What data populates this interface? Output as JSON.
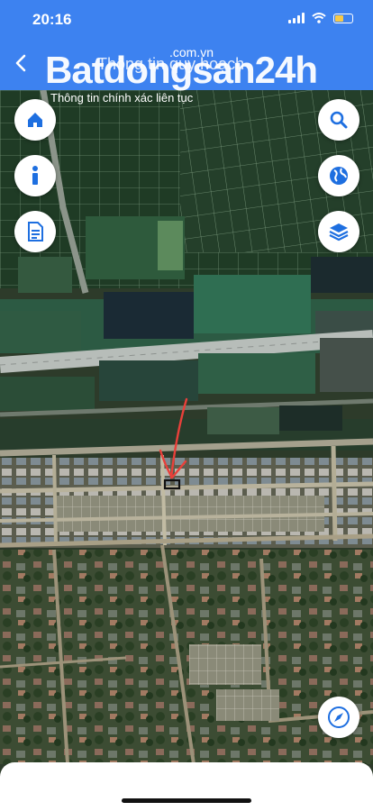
{
  "status_bar": {
    "time": "20:16"
  },
  "header": {
    "back_icon": "back-arrow-icon",
    "title": "Thông tin quy hoạch"
  },
  "watermark": {
    "brand": "Batdongsan24h",
    "domain": ".com.vn",
    "tagline": "Thông tin chính xác liên tục"
  },
  "map_controls": {
    "left": [
      {
        "name": "home-button",
        "icon": "home-icon"
      },
      {
        "name": "info-button",
        "icon": "info-icon"
      },
      {
        "name": "document-button",
        "icon": "document-icon"
      }
    ],
    "right": [
      {
        "name": "search-button",
        "icon": "search-icon"
      },
      {
        "name": "globe-button",
        "icon": "globe-icon"
      },
      {
        "name": "layers-button",
        "icon": "layers-icon"
      }
    ],
    "compass": {
      "name": "compass-button",
      "icon": "compass-icon"
    }
  },
  "colors": {
    "header_bg": "#3d82f0",
    "icon_blue": "#1e6fe0",
    "annotation_red": "#e8403a"
  }
}
